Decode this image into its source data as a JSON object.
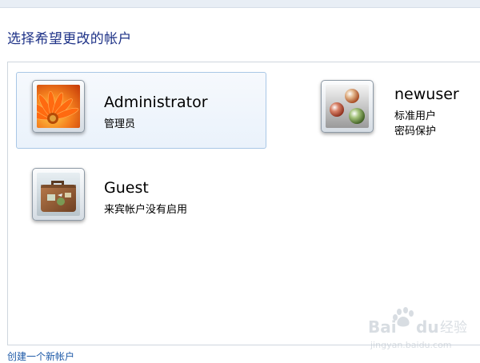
{
  "header": {
    "title": "选择希望更改的帐户"
  },
  "accounts": [
    {
      "name": "Administrator",
      "lines": [
        "管理员"
      ],
      "picture": "orange-flower-picture",
      "selected": true
    },
    {
      "name": "newuser",
      "lines": [
        "标准用户",
        "密码保护"
      ],
      "picture": "marbles-picture",
      "selected": false
    },
    {
      "name": "Guest",
      "lines": [
        "来宾帐户没有启用"
      ],
      "picture": "suitcase-picture",
      "selected": false
    }
  ],
  "footer": {
    "create_account_link": "创建一个新帐户"
  },
  "watermark": {
    "text": "Baidu经验",
    "url": "jingyan.baidu.com"
  },
  "colors": {
    "title": "#1e3287",
    "link": "#1e5aa8",
    "selection": "#eaf2fb",
    "selection_border": "#a9c7e6"
  }
}
